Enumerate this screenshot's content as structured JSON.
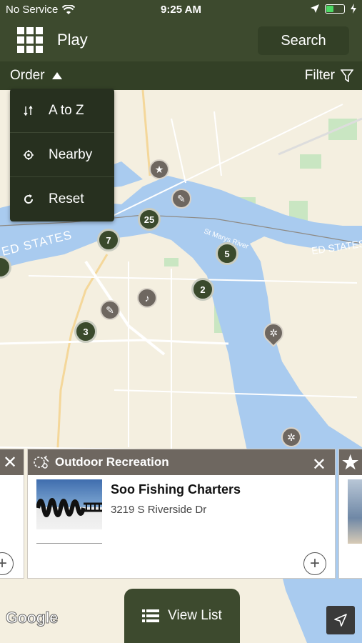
{
  "status_bar": {
    "carrier": "No Service",
    "time": "9:25 AM"
  },
  "header": {
    "title": "Play",
    "search_label": "Search"
  },
  "subbar": {
    "order_label": "Order",
    "filter_label": "Filter"
  },
  "order_menu": {
    "items": [
      {
        "label": "A to Z",
        "icon": "sort-icon"
      },
      {
        "label": "Nearby",
        "icon": "crosshair-icon"
      },
      {
        "label": "Reset",
        "icon": "reset-icon"
      }
    ]
  },
  "map": {
    "labels": {
      "country": "ED STATES",
      "country_right": "ED STATES",
      "river": "St Marys River"
    },
    "clusters": [
      "25",
      "7",
      "5",
      "2",
      "3"
    ]
  },
  "card": {
    "category": "Outdoor Recreation",
    "name": "Soo Fishing Charters",
    "address": "3219 S Riverside Dr"
  },
  "footer": {
    "view_list_label": "View List",
    "attribution": "Google"
  },
  "colors": {
    "brand_dark": "#3d4a2e",
    "brand_darker": "#334026",
    "category_bar": "#6e6760",
    "water": "#a9cbef"
  }
}
